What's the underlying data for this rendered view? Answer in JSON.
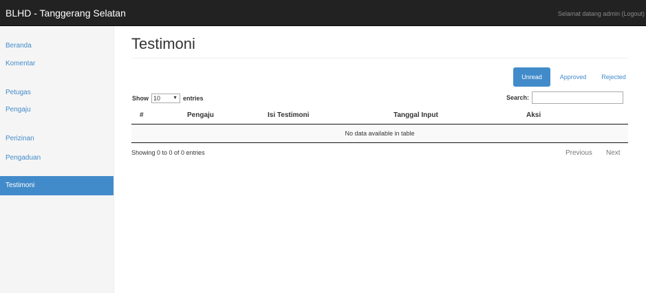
{
  "navbar": {
    "brand": "BLHD - Tanggerang Selatan",
    "welcome": "Selamat datang admin",
    "logout": "(Logout)"
  },
  "sidebar": {
    "items": [
      {
        "label": "Beranda"
      },
      {
        "label": "Komentar"
      },
      {
        "label": "Petugas"
      },
      {
        "label": "Pengaju"
      },
      {
        "label": "Perizinan"
      },
      {
        "label": "Pengaduan"
      },
      {
        "label": "Testimoni"
      }
    ],
    "active": "Testimoni"
  },
  "page": {
    "title": "Testimoni"
  },
  "tabs": [
    {
      "label": "Unread",
      "active": true
    },
    {
      "label": "Approved",
      "active": false
    },
    {
      "label": "Rejected",
      "active": false
    }
  ],
  "table": {
    "show_label": "Show",
    "page_size": "10",
    "entries_label": "entries",
    "search_label": "Search:",
    "search_value": "",
    "columns": [
      "#",
      "Pengaju",
      "Isi Testimoni",
      "Tanggal Input",
      "Aksi"
    ],
    "empty_message": "No data available in table",
    "info": "Showing 0 to 0 of 0 entries",
    "prev_label": "Previous",
    "next_label": "Next"
  },
  "colors": {
    "navbar_bg": "#222222",
    "accent": "#428bca",
    "sidebar_bg": "#f5f5f5"
  }
}
